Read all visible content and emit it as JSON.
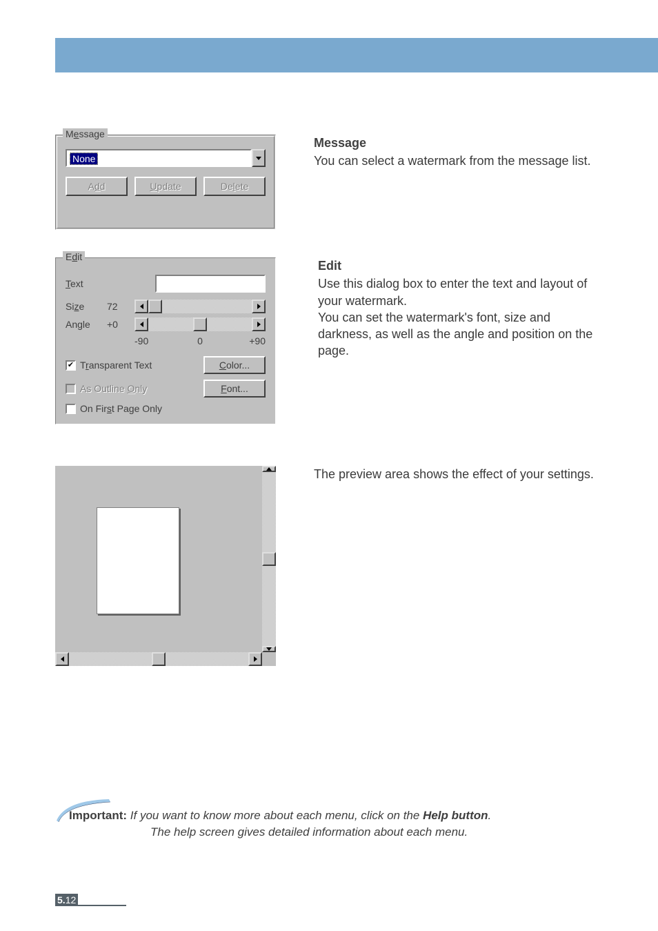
{
  "message": {
    "group_label": "Message",
    "group_underline": "e",
    "selected": "None",
    "buttons": {
      "add": "Add",
      "update": "Update",
      "delete": "Delete"
    },
    "heading": "Message",
    "body": "You can select a watermark from the message list."
  },
  "edit": {
    "group_label": "Edit",
    "text_label": "Text",
    "size_label": "Size",
    "size_value": "72",
    "angle_label": "Angle",
    "angle_value": "+0",
    "scale": {
      "min": "-90",
      "mid": "0",
      "max": "+90"
    },
    "checks": {
      "transparent": "Transparent Text",
      "outline": "As Outline Only",
      "firstpage": "On First Page Only"
    },
    "color_btn": "Color...",
    "font_btn": "Font...",
    "heading": "Edit",
    "body1": "Use this dialog box to enter the text and layout of your watermark.",
    "body2": "You can set the watermark's font, size and darkness, as well as the angle and position on the page."
  },
  "preview": {
    "body": "The preview area shows the effect of your settings."
  },
  "note": {
    "important": "Important:",
    "line1": "If you want to know more about each menu, click on the ",
    "help_button": "Help button",
    "line1_end": ".",
    "line2": "The help screen gives detailed information about each menu."
  },
  "footer": {
    "chapter": "5.",
    "page": "12"
  }
}
